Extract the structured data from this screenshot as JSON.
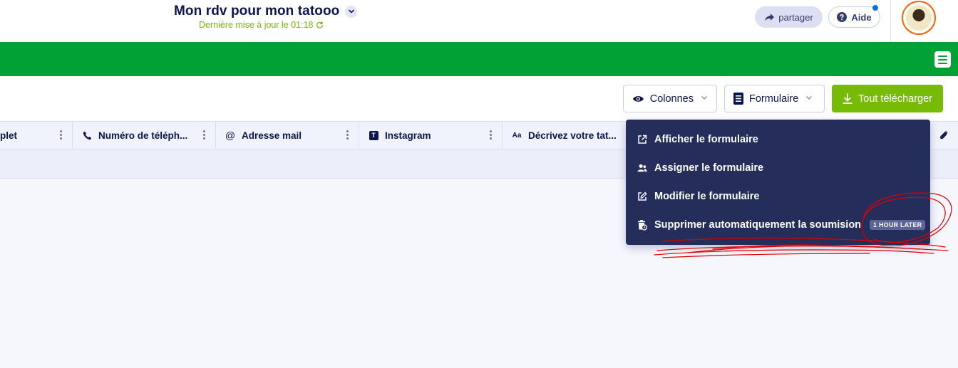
{
  "header": {
    "form_title": "Mon rdv pour mon tatooo",
    "last_update": "Dernière mise à jour le 01:18",
    "share_label": "partager",
    "help_label": "Aide"
  },
  "toolbar": {
    "columns_label": "Colonnes",
    "form_label": "Formulaire",
    "download_label": "Tout télécharger"
  },
  "table": {
    "columns": [
      {
        "label": "plet",
        "icon": "none"
      },
      {
        "label": "Numéro de téléph...",
        "icon": "phone-icon"
      },
      {
        "label": "Adresse mail",
        "icon": "at-icon"
      },
      {
        "label": "Instagram",
        "icon": "text-box-icon"
      },
      {
        "label": "Décrivez votre tat...",
        "icon": "font-icon"
      }
    ],
    "column_icon_text": {
      "at": "@",
      "text": "T",
      "font": "Aa"
    }
  },
  "form_menu": {
    "items": [
      {
        "label": "Afficher le formulaire",
        "icon": "external-link-icon"
      },
      {
        "label": "Assigner le formulaire",
        "icon": "assign-user-icon"
      },
      {
        "label": "Modifier le formulaire",
        "icon": "edit-icon"
      },
      {
        "label": "Supprimer automatiquement la soumision",
        "icon": "auto-delete-icon",
        "badge": "1 HOUR LATER"
      }
    ]
  },
  "colors": {
    "brand_green": "#01a135",
    "accent_lime": "#78bb07",
    "navy": "#0a1551",
    "menu_bg": "#252d5b",
    "avatar_ring": "#ff6100",
    "annotation_red": "#e00000"
  }
}
